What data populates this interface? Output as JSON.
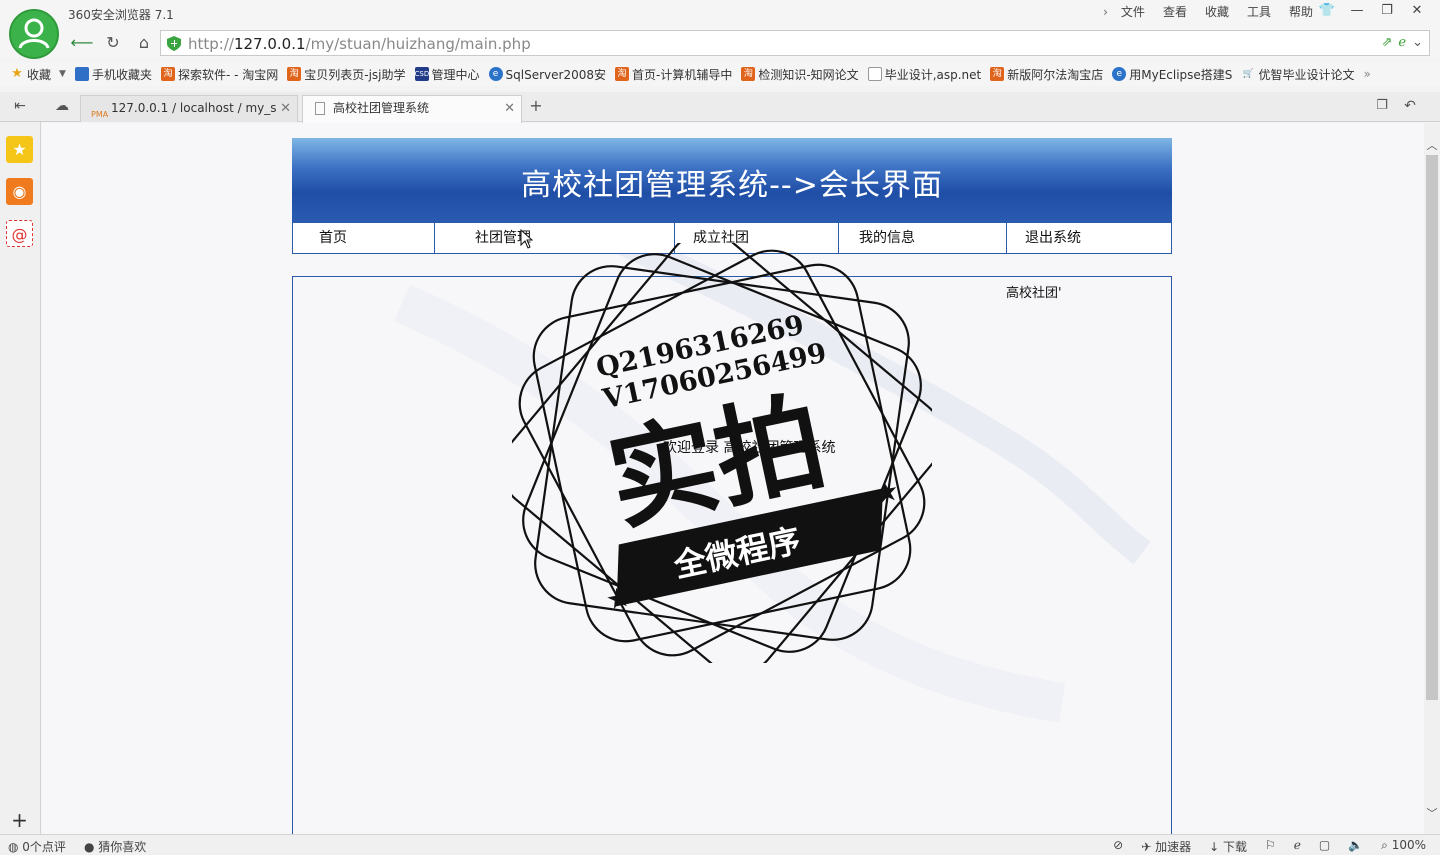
{
  "browser": {
    "app_title": "360安全浏览器 7.1",
    "menu": [
      "文件",
      "查看",
      "收藏",
      "工具",
      "帮助"
    ],
    "url_prefix": "http://",
    "url_host": "127.0.0.1",
    "url_path": "/my/stuan/huizhang/main.php"
  },
  "bookmarks": [
    {
      "label": "收藏",
      "icon": "star-icon"
    },
    {
      "label": "手机收藏夹",
      "icon": "phone-icon"
    },
    {
      "label": "探索软件- - 淘宝网",
      "icon": "taobao-icon"
    },
    {
      "label": "宝贝列表页-jsj助学",
      "icon": "taobao-icon"
    },
    {
      "label": "管理中心",
      "icon": "site-icon"
    },
    {
      "label": "SqlServer2008安",
      "icon": "globe-icon"
    },
    {
      "label": "首页-计算机辅导中",
      "icon": "taobao-icon"
    },
    {
      "label": "检测知识-知网论文",
      "icon": "taobao-icon"
    },
    {
      "label": "毕业设计,asp.net",
      "icon": "doc-icon"
    },
    {
      "label": "新版阿尔法淘宝店",
      "icon": "taobao-icon"
    },
    {
      "label": "用MyEclipse搭建S",
      "icon": "globe-icon"
    },
    {
      "label": "优智毕业设计论文",
      "icon": "cart-icon"
    }
  ],
  "tabs": [
    {
      "title": "127.0.0.1 / localhost / my_s"
    },
    {
      "title": "高校社团管理系统"
    }
  ],
  "page": {
    "header_title": "高校社团管理系统-->会长界面",
    "nav": [
      "首页",
      "社团管理",
      "成立社团",
      "我的信息",
      "退出系统"
    ],
    "marquee": "高校社团'",
    "welcome": "欢迎登录  高校社团管理系统"
  },
  "watermark": {
    "line1": "Q2196316269",
    "line2": "V17060256499",
    "big": "实拍",
    "banner": "全微程序"
  },
  "statusbar": {
    "comments": "0个点评",
    "guess": "猜你喜欢",
    "accelerator": "加速器",
    "download": "下载",
    "zoom": "100%"
  }
}
